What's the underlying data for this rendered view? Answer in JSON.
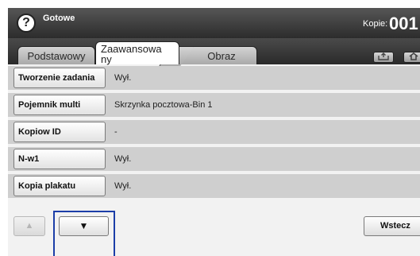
{
  "header": {
    "help_icon": "?",
    "status": "Gotowe",
    "copies_label": "Kopie:",
    "copies_value": "001"
  },
  "tabs": [
    {
      "label": "Podstawowy",
      "active": false
    },
    {
      "label_line1": "Zaawansowa",
      "label_line2": "ny",
      "active": true
    },
    {
      "label": "Obraz",
      "active": false
    }
  ],
  "toolbar_icons": [
    "save-icon",
    "home-icon"
  ],
  "rows": [
    {
      "label": "Tworzenie zadania",
      "value": "Wył."
    },
    {
      "label": "Pojemnik multi",
      "value": "Skrzynka pocztowa-Bin 1"
    },
    {
      "label": "Kopiow ID",
      "value": "-"
    },
    {
      "label": "N-w1",
      "value": "Wył."
    },
    {
      "label": "Kopia plakatu",
      "value": "Wył."
    }
  ],
  "nav": {
    "up_icon": "▲",
    "down_icon": "▼"
  },
  "footer": {
    "back_label": "Wstecz"
  },
  "colors": {
    "row_background": "#cfcfcf",
    "highlight_frame": "#1c3ea8"
  }
}
